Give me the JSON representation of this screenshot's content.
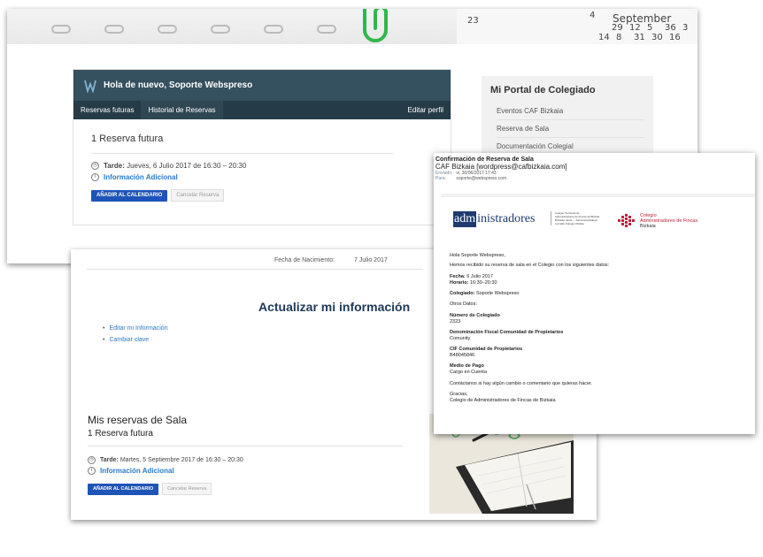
{
  "calendar": {
    "month": "September",
    "numbers": [
      "4",
      "29",
      "12",
      "5",
      "36",
      "3",
      "14",
      "8",
      "31",
      "30",
      "16",
      "23"
    ]
  },
  "portal": {
    "greeting": "Hola de nuevo, Soporte Webspreso",
    "tabs": [
      "Reservas futuras",
      "Historial de Reservas"
    ],
    "edit_profile": "Editar perfil",
    "reservation_count": "1 Reserva futura",
    "reservation": {
      "label": "Tarde:",
      "when": "Jueves, 6 Julio 2017  de 16:30 – 20:30",
      "info": "Información Adicional",
      "add_calendar": "AÑADIR AL CALENDARIO",
      "cancel": "Cancelar Reserva"
    }
  },
  "sidebar": {
    "title": "Mi Portal de Colegiado",
    "items": [
      "Eventos CAF Bizkaia",
      "Reserva de Sala",
      "Documentación Colegial"
    ]
  },
  "profile": {
    "birth_label": "Fecha de Nacimiento:",
    "birth_value": "7 Julio 2017",
    "update_title": "Actualizar mi información",
    "links": [
      "Editar mi Información",
      "Cambiar clave"
    ]
  },
  "my_reservations": {
    "title": "Mis reservas de Sala",
    "count": "1 Reserva futura",
    "label": "Tarde:",
    "when": "Martes, 5 Septiembre 2017  de 16:30 – 20:30",
    "info": "Información Adicional",
    "add_calendar": "AÑADIR AL CALENDARIO",
    "cancel": "Cancelar Reserva"
  },
  "email": {
    "subject": "Confirmación de Reserva de Sala",
    "from": "CAF Bizkaia [wordpress@cafbizkaia.com]",
    "sent_label": "Enviado:",
    "sent_value": "vi. 30/06/2017 17:43",
    "to_label": "Para:",
    "to_value": "soporte@webspreso.com",
    "logo_left": "administradores",
    "logo_left_prefix": "adm",
    "logo_left_sub": [
      "Colegio Territorial de",
      "Administradores de Fincas de Bizkaia",
      "Bizkaiko Jauts … Administratzaileen",
      "Lurralde Kolegio Ofiziala"
    ],
    "logo_right": [
      "Colegio",
      "Administradores de Fincas",
      "Bizkaia"
    ],
    "greeting": "Hola Soporte Webspreso,",
    "intro": "Hemos recibido su reserva de sala en el Colegio con los siguientes datos:",
    "fecha_label": "Fecha:",
    "fecha_value": "6 Julio 2017",
    "horario_label": "Horario:",
    "horario_value": "16:30–20:30",
    "colegiado_label": "Colegiado:",
    "colegiado_value": "Soporte Webspreso",
    "otros": "Otros Datos:",
    "numero_label": "Número de Colegiado",
    "numero_value": "2323",
    "denominacion_label": "Denominación Fiscal Comunidad de Propietarios",
    "denominacion_value": "Comunity",
    "cif_label": "CIF Comunidad de Propietarios",
    "cif_value": "B48045846",
    "medio_label": "Medio de Pago",
    "medio_value": "Cargo en Cuenta",
    "contact": "Contáctanos si hay algún cambio o comentario que quieras hacer.",
    "thanks": "Gracias,",
    "signature": "Colegio de Administradores de Fincas de Bizkaia"
  },
  "colors": {
    "header": "#35505e",
    "tabs": "#253b47",
    "primary": "#1e54b8",
    "link": "#2a7ac7",
    "title": "#1d3a57"
  }
}
